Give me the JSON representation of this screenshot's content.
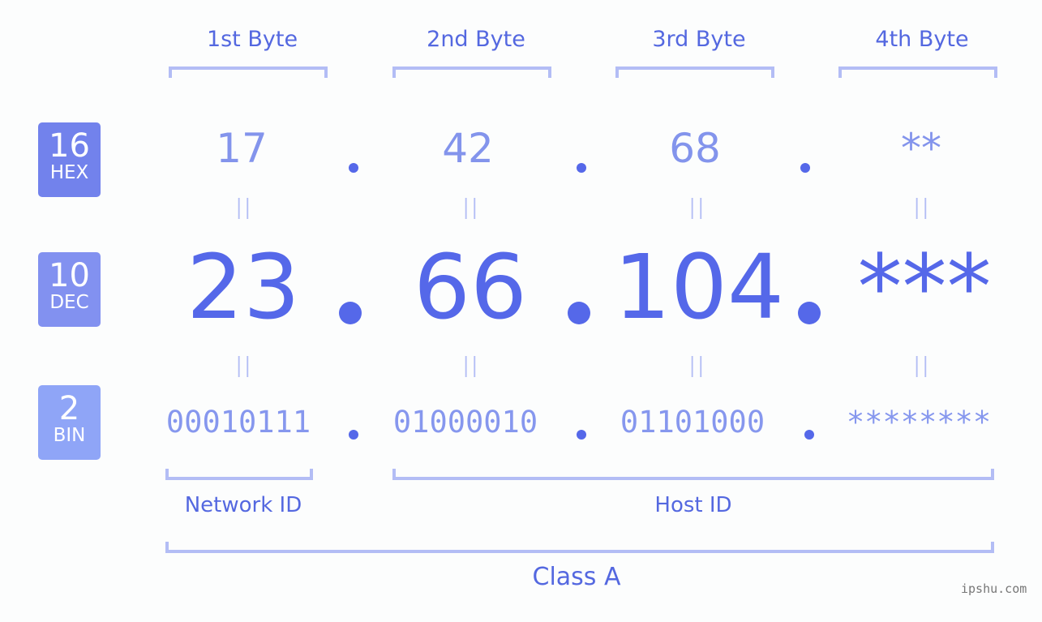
{
  "headers": [
    "1st Byte",
    "2nd Byte",
    "3rd Byte",
    "4th Byte"
  ],
  "badges": {
    "hex": {
      "num": "16",
      "label": "HEX",
      "color": "#7282ec"
    },
    "dec": {
      "num": "10",
      "label": "DEC",
      "color": "#8291f0"
    },
    "bin": {
      "num": "2",
      "label": "BIN",
      "color": "#8fa5f7"
    }
  },
  "hex": [
    "17",
    "42",
    "68",
    "**"
  ],
  "dec": [
    "23",
    "66",
    "104",
    "***"
  ],
  "bin": [
    "00010111",
    "01000010",
    "01101000",
    "********"
  ],
  "equals": "II",
  "labels": {
    "network": "Network ID",
    "host": "Host ID",
    "class": "Class A"
  },
  "watermark": "ipshu.com"
}
